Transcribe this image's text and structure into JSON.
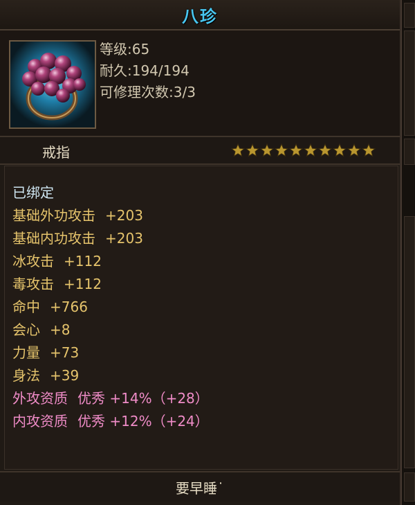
{
  "item": {
    "name": "八珍",
    "level_text": "等级:65",
    "durability_text": "耐久:194/194",
    "repair_text": "可修理次数:3/3",
    "type": "戒指",
    "star_count": 10,
    "icon": "ring-icon"
  },
  "attributes": [
    {
      "label": "已绑定",
      "value": "",
      "color": "#cfe6f2"
    },
    {
      "label": "基础外功攻击",
      "value": "+203",
      "color": "#e6c46c"
    },
    {
      "label": "基础内功攻击",
      "value": "+203",
      "color": "#e6c46c"
    },
    {
      "label": "冰攻击",
      "value": "+112",
      "color": "#e6c46c"
    },
    {
      "label": "毒攻击",
      "value": "+112",
      "color": "#e6c46c"
    },
    {
      "label": "命中",
      "value": "+766",
      "color": "#e6c46c"
    },
    {
      "label": "会心",
      "value": "+8",
      "color": "#e6c46c"
    },
    {
      "label": "力量",
      "value": "+73",
      "color": "#e6c46c"
    },
    {
      "label": "身法",
      "value": "+39",
      "color": "#e6c46c"
    },
    {
      "label": "外攻资质",
      "value": "优秀 +14%（+28）",
      "color": "#f08cc8"
    },
    {
      "label": "内攻资质",
      "value": "优秀 +12%（+24）",
      "color": "#f08cc8"
    }
  ],
  "footer": {
    "text": "要早睡˙"
  },
  "colors": {
    "title": "#48c6f0",
    "star": "#b9962f",
    "frame": "#6d5a43"
  }
}
